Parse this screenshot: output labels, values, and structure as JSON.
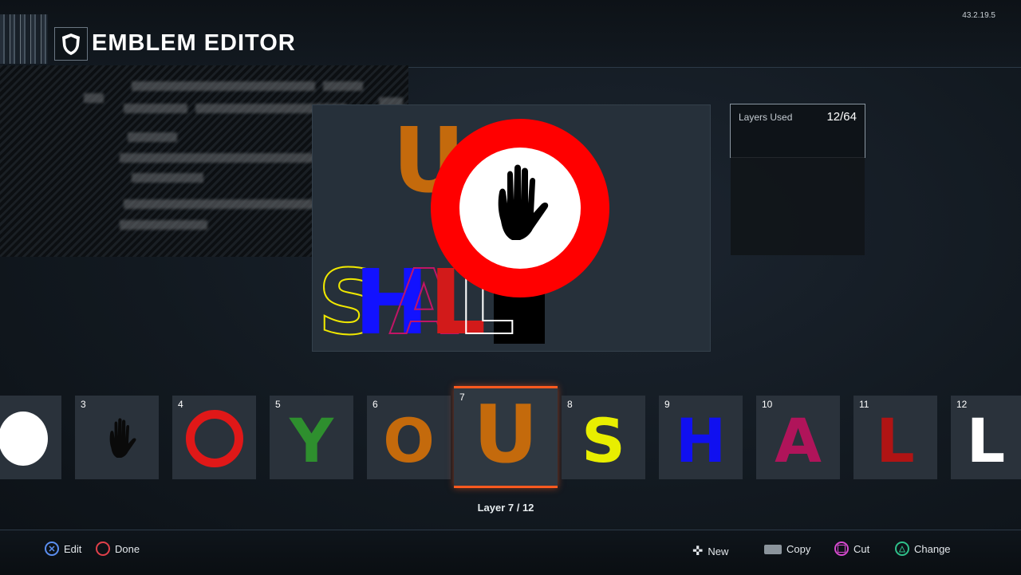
{
  "header": {
    "title": "EMBLEM EDITOR",
    "version": "43.2.19.5"
  },
  "layers_used": {
    "label": "Layers Used",
    "value": "12/64"
  },
  "canvas": {
    "letters": [
      {
        "char": "S",
        "color": "#f0e800",
        "style": "outline"
      },
      {
        "char": "H",
        "color": "#1212ff",
        "style": "fill"
      },
      {
        "char": "A",
        "color": "#c01566",
        "style": "outline"
      },
      {
        "char": "L",
        "color": "#d21a1a",
        "style": "fill"
      },
      {
        "char": "L",
        "color": "#ffffff",
        "style": "outline"
      },
      {
        "char": "U",
        "color": "#c46a0c",
        "style": "fill"
      }
    ]
  },
  "layers": [
    {
      "num": "",
      "icon": "white-circle"
    },
    {
      "num": "3",
      "icon": "hand"
    },
    {
      "num": "4",
      "icon": "red-ring"
    },
    {
      "num": "5",
      "char": "Y",
      "color": "#2e8f2e"
    },
    {
      "num": "6",
      "char": "O",
      "color": "#c46a0c"
    },
    {
      "num": "7",
      "char": "U",
      "color": "#c46a0c",
      "selected": true
    },
    {
      "num": "8",
      "char": "S",
      "color": "#e8ee00"
    },
    {
      "num": "9",
      "char": "H",
      "color": "#1010f0"
    },
    {
      "num": "10",
      "char": "A",
      "color": "#b0145a"
    },
    {
      "num": "11",
      "char": "L",
      "color": "#b01414"
    },
    {
      "num": "12",
      "char": "L",
      "color": "#ffffff"
    }
  ],
  "layer_indicator": "Layer 7 / 12",
  "footer": {
    "left": [
      {
        "label": "Edit",
        "icon": "cross-button-icon",
        "color": "#5b8ef0"
      },
      {
        "label": "Done",
        "icon": "circle-button-icon",
        "color": "#e0404a"
      }
    ],
    "right": [
      {
        "label": "New",
        "icon": "dpad-icon"
      },
      {
        "label": "Copy",
        "icon": "touchpad-icon"
      },
      {
        "label": "Cut",
        "icon": "square-button-icon",
        "color": "#d84ad0"
      },
      {
        "label": "Change",
        "icon": "triangle-button-icon",
        "color": "#2fc08a"
      }
    ]
  },
  "colors": {
    "accent": "#ff5a1f",
    "stop_red": "#ff0000"
  }
}
